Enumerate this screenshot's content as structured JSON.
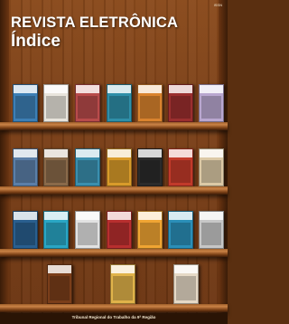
{
  "header": {
    "title": "REVISTA ELETRÔNICA",
    "subtitle": "Índice",
    "corner_mark": "ISSN"
  },
  "footer": {
    "text": "Tribunal Regional do Trabalho da 9ª Região"
  },
  "shelves": [
    {
      "name": "shelf-1",
      "books": [
        {
          "color": "#3d7fb5"
        },
        {
          "color": "#e8e4dc"
        },
        {
          "color": "#b84b4b"
        },
        {
          "color": "#2f8fa8"
        },
        {
          "color": "#d9832e"
        },
        {
          "color": "#9b2f2f"
        },
        {
          "color": "#b9a7d0"
        }
      ]
    },
    {
      "name": "shelf-2",
      "books": [
        {
          "color": "#5b7fa8"
        },
        {
          "color": "#8a6a4a"
        },
        {
          "color": "#3a8fae"
        },
        {
          "color": "#d99b2a"
        },
        {
          "color": "#2b2b2b"
        },
        {
          "color": "#c23a2a"
        },
        {
          "color": "#dcc9a6"
        }
      ]
    },
    {
      "name": "shelf-3",
      "books": [
        {
          "color": "#2a5f8f"
        },
        {
          "color": "#2aa6c4"
        },
        {
          "color": "#e2e2e2"
        },
        {
          "color": "#b82f2f"
        },
        {
          "color": "#f0a533"
        },
        {
          "color": "#2b8fb8"
        },
        {
          "color": "#c7c7c7"
        }
      ]
    },
    {
      "name": "shelf-4",
      "books": [
        {
          "color": "#7a3e1a"
        },
        {
          "color": "#e0b34a"
        },
        {
          "color": "#e6d9c6"
        }
      ]
    }
  ]
}
